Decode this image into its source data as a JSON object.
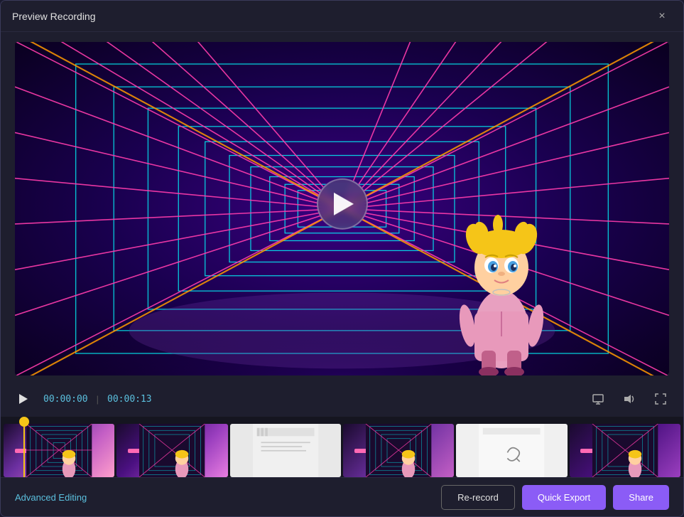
{
  "window": {
    "title": "Preview Recording",
    "close_label": "×"
  },
  "controls": {
    "play_button_label": "▶",
    "time_current": "00:00:00",
    "time_separator": "|",
    "time_total": "00:00:13"
  },
  "bottom": {
    "advanced_editing_label": "Advanced Editing",
    "rerecord_label": "Re-record",
    "quick_export_label": "Quick Export",
    "share_label": "Share"
  },
  "icons": {
    "fullscreen": "⛶",
    "volume": "🔊",
    "expand": "⤢",
    "close": "×"
  }
}
